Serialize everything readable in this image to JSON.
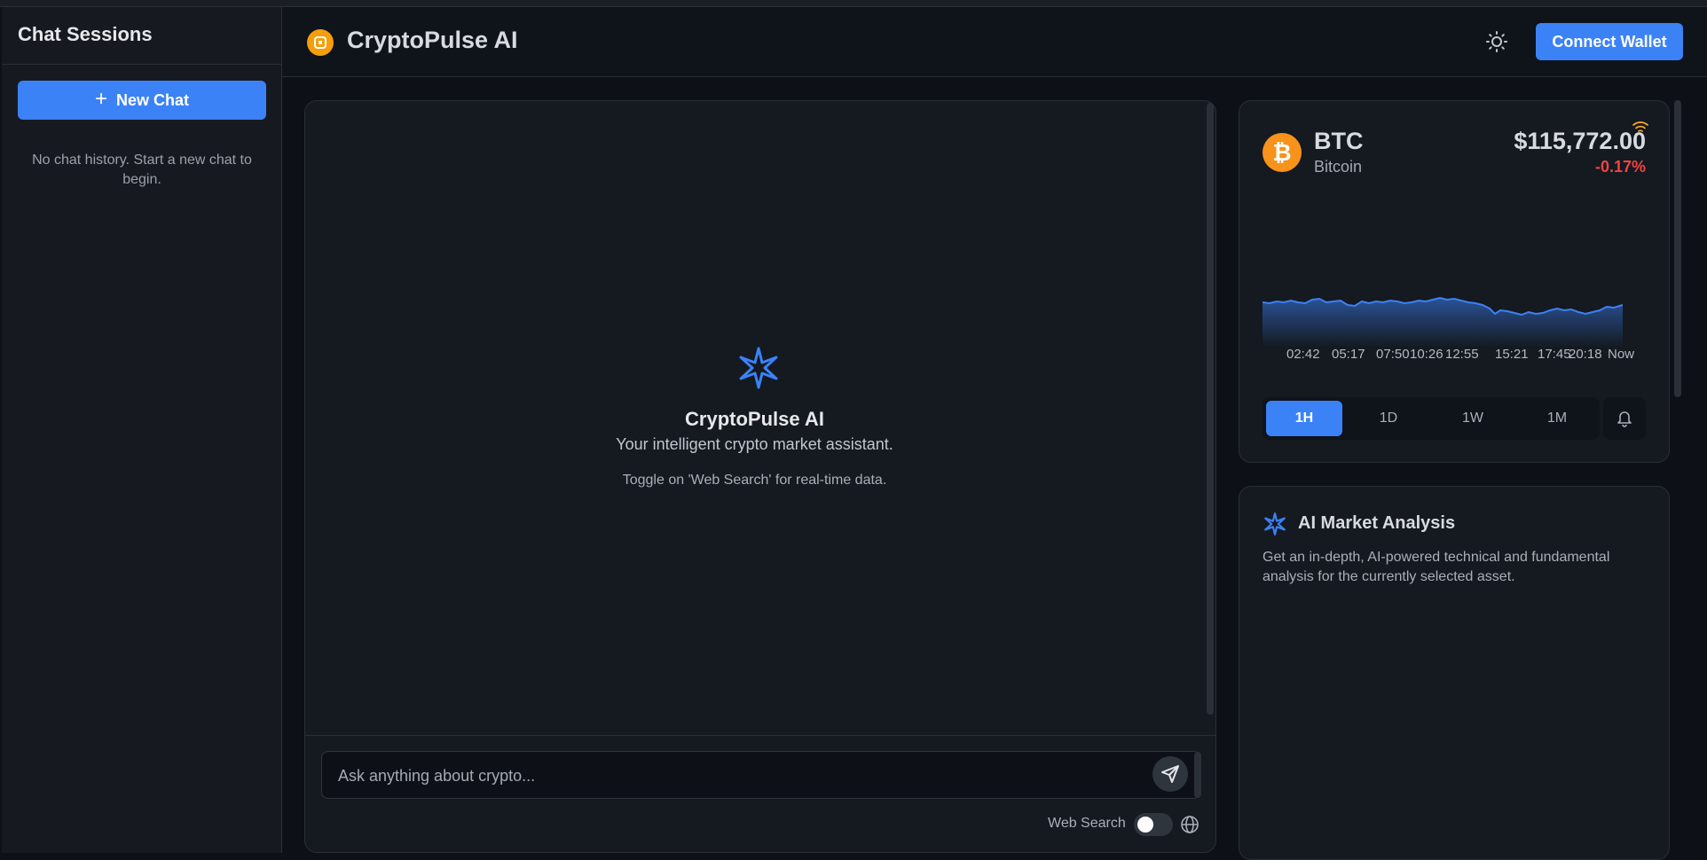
{
  "sidebar": {
    "title": "Chat Sessions",
    "new_chat_label": "New Chat",
    "empty_text": "No chat history. Start a new chat to begin."
  },
  "header": {
    "brand": "CryptoPulse AI",
    "connect_wallet_label": "Connect Wallet",
    "theme_icon": "sun-icon"
  },
  "chat": {
    "title": "CryptoPulse AI",
    "subtitle": "Your intelligent crypto market assistant.",
    "hint": "Toggle on 'Web Search' for real-time data.",
    "input_placeholder": "Ask anything about crypto...",
    "web_search_label": "Web Search",
    "web_search_on": false
  },
  "ticker": {
    "symbol": "BTC",
    "name": "Bitcoin",
    "price": "$115,772.00",
    "change": "-0.17%",
    "accent": "#3b82f6",
    "negative_color": "#ef4444",
    "x_ticks": [
      "02:42",
      "05:17",
      "07:50",
      "10:26",
      "12:55",
      "15:21",
      "17:45",
      "20:18",
      "Now"
    ],
    "timeframes": [
      "1H",
      "1D",
      "1W",
      "1M"
    ],
    "selected_timeframe": "1H"
  },
  "analysis": {
    "title": "AI Market Analysis",
    "description": "Get an in-depth, AI-powered technical and fundamental analysis for the currently selected asset."
  }
}
